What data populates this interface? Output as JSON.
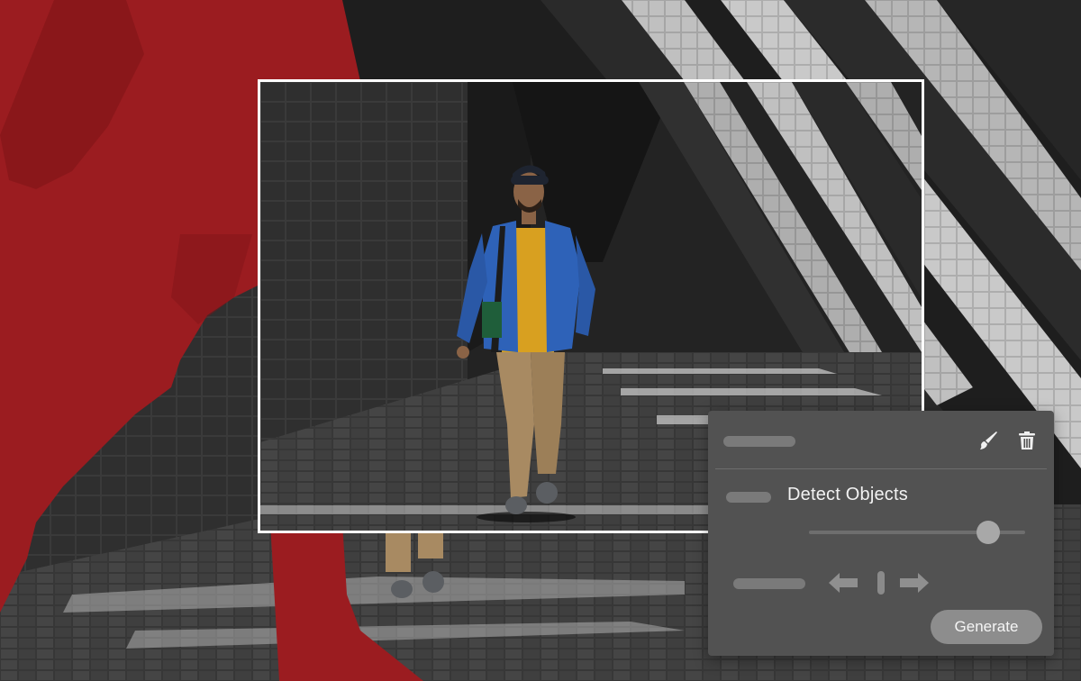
{
  "panel": {
    "detect_label": "Detect Objects",
    "slider_value": 0.83,
    "generate_label": "Generate",
    "icons": {
      "brush": "paintbrush-icon",
      "trash": "trash-icon",
      "left": "arrow-left-icon",
      "right": "arrow-right-icon"
    }
  },
  "colors": {
    "mask_red": "#9b1c20",
    "frame_border": "#ffffff",
    "panel_bg": "#525252",
    "jacket_blue": "#2e62b8",
    "shirt_yellow": "#d8a020",
    "pants_khaki": "#a88a62"
  }
}
